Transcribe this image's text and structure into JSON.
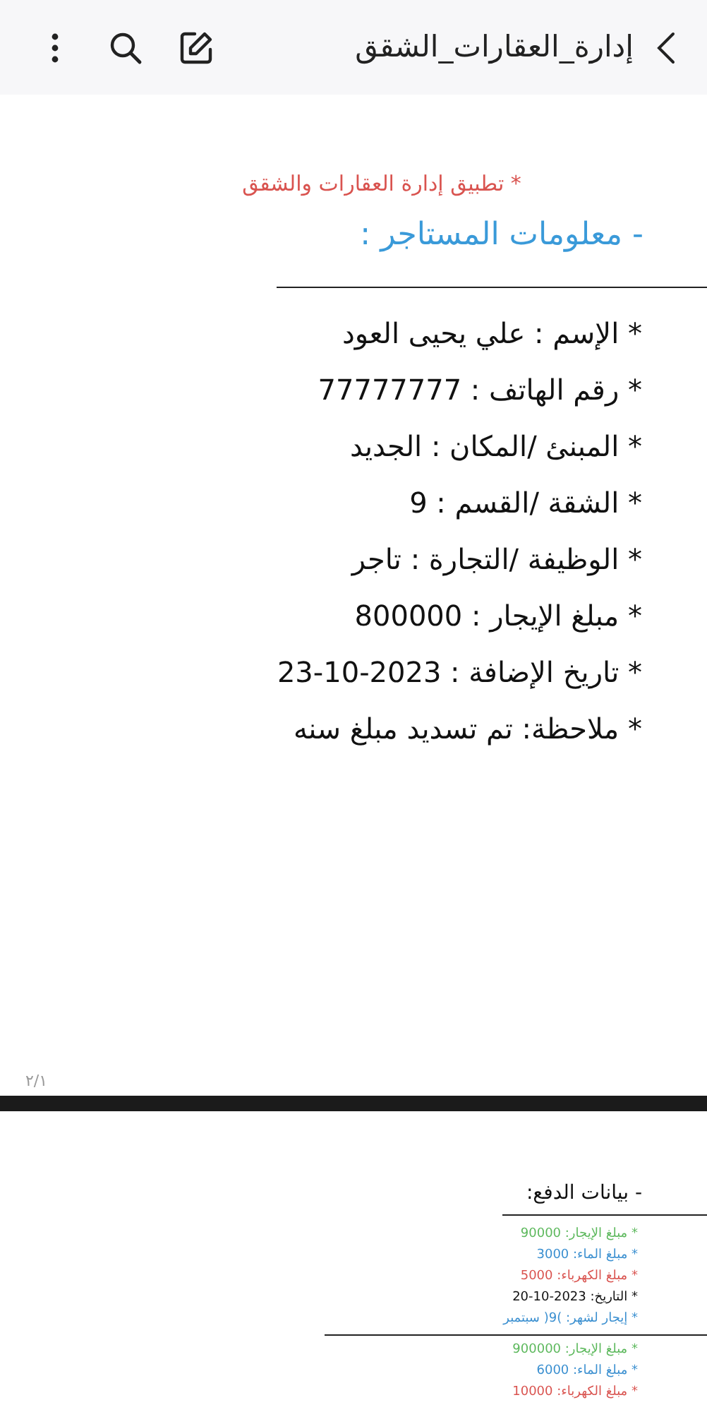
{
  "toolbar": {
    "title": "إدارة_العقارات_الشقق"
  },
  "page_1": {
    "app_title": "* تطبيق إدارة العقارات والشقق",
    "heading": "- معلومات المستاجر :",
    "fields": [
      "* الإسم : علي يحيى العود",
      "* رقم الهاتف : 77777777",
      "* المبنئ /المكان : الجديد",
      "* الشقة /القسم : 9",
      "* الوظيفة /التجارة : تاجر",
      "* مبلغ الإيجار : 800000",
      "* تاريخ الإضافة : 2023-10-23",
      "* ملاحظة: تم تسديد مبلغ سنه"
    ],
    "page_number": "٢/١"
  },
  "page_2": {
    "heading": "- بيانات الدفع:",
    "payments": [
      {
        "lines": [
          {
            "text": "* مبلغ الإيجار: 90000",
            "color": "#5cb85c"
          },
          {
            "text": "* مبلغ الماء: 3000",
            "color": "#3a8fd0"
          },
          {
            "text": "* مبلغ الكهرباء: 5000",
            "color": "#d9534f"
          },
          {
            "text": "* التاريخ: 2023-10-20",
            "color": "#111111"
          },
          {
            "text": "* إيجار لشهر: )9( سبتمبر",
            "color": "#3a8fd0"
          }
        ]
      },
      {
        "lines": [
          {
            "text": "* مبلغ الإيجار: 900000",
            "color": "#5cb85c"
          },
          {
            "text": "* مبلغ الماء: 6000",
            "color": "#3a8fd0"
          },
          {
            "text": "* مبلغ الكهرباء: 10000",
            "color": "#d9534f"
          }
        ]
      }
    ]
  }
}
